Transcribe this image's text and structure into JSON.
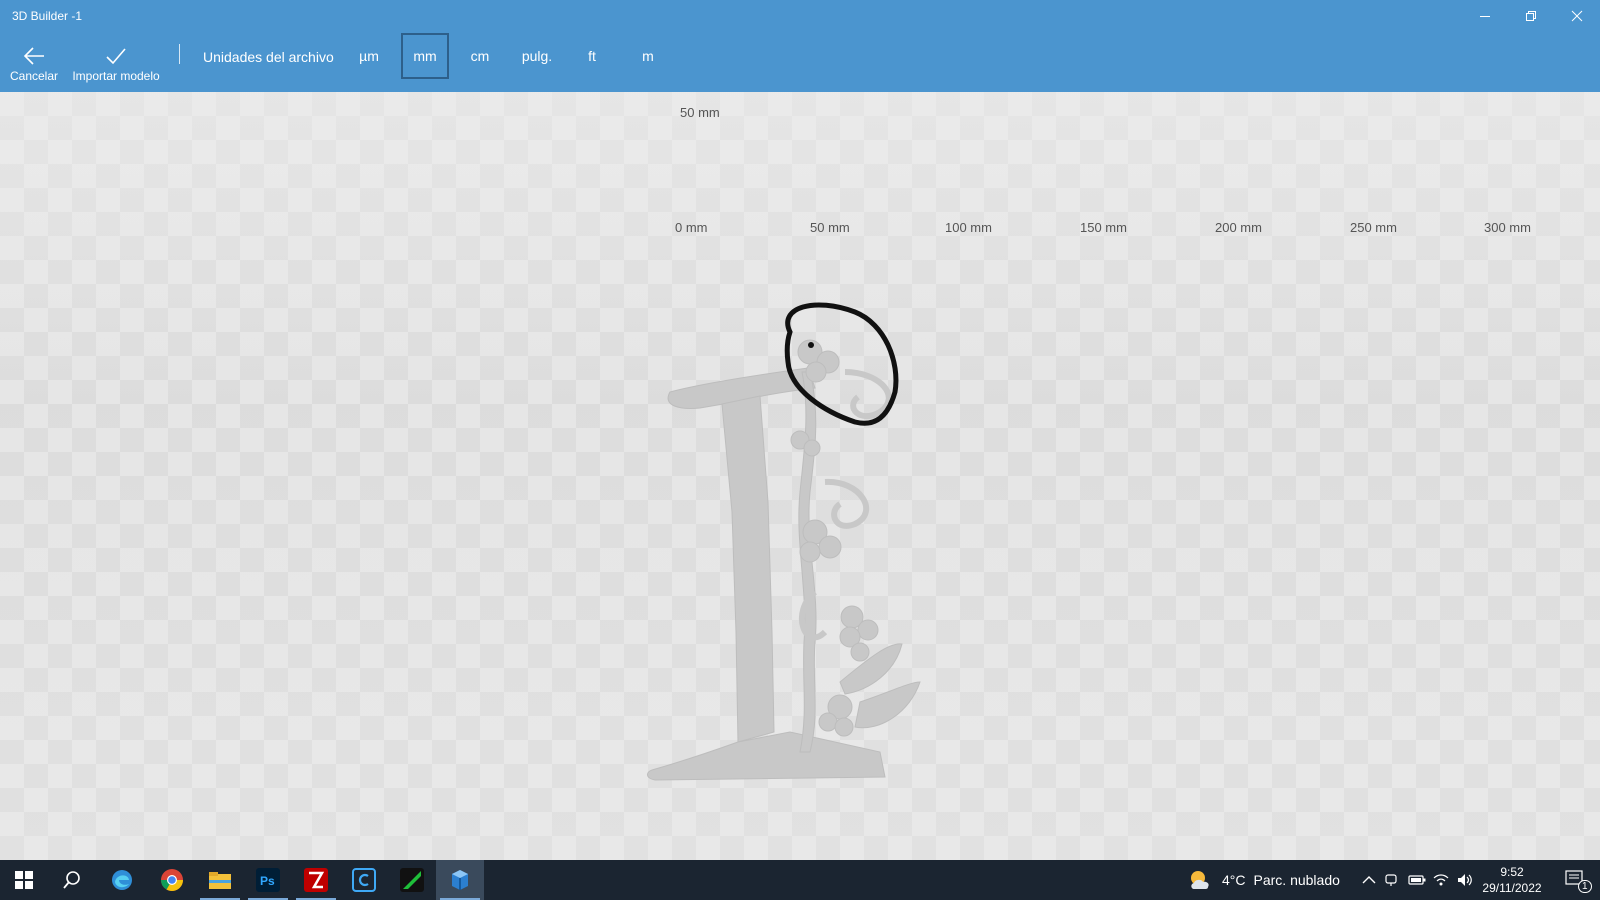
{
  "window": {
    "title": "3D Builder -1",
    "controls": [
      "minimize-icon",
      "restore-icon",
      "close-icon"
    ]
  },
  "toolbar": {
    "cancel_label": "Cancelar",
    "import_label": "Importar modelo",
    "units_label": "Unidades del archivo",
    "units": [
      "µm",
      "mm",
      "cm",
      "pulg.",
      "ft",
      "m"
    ],
    "selected_unit": "mm"
  },
  "viewport": {
    "top_ruler_label": "50 mm",
    "ruler_ticks": [
      "0 mm",
      "50 mm",
      "100 mm",
      "150 mm",
      "200 mm",
      "250 mm",
      "300 mm"
    ],
    "model_color": "#c8c8c8",
    "annotation_color": "#111111"
  },
  "taskbar": {
    "apps": [
      "windows-start-icon",
      "search-icon",
      "edge-icon",
      "chrome-icon",
      "file-explorer-icon",
      "photoshop-icon",
      "filezilla-icon",
      "c-app-icon",
      "green-app-icon",
      "3d-builder-icon"
    ],
    "weather": {
      "temp": "4°C",
      "condition": "Parc. nublado"
    },
    "time": "9:52",
    "date": "29/11/2022",
    "notifications": "1"
  },
  "colors": {
    "accent": "#4b95cf",
    "taskbar": "#1b2531"
  }
}
